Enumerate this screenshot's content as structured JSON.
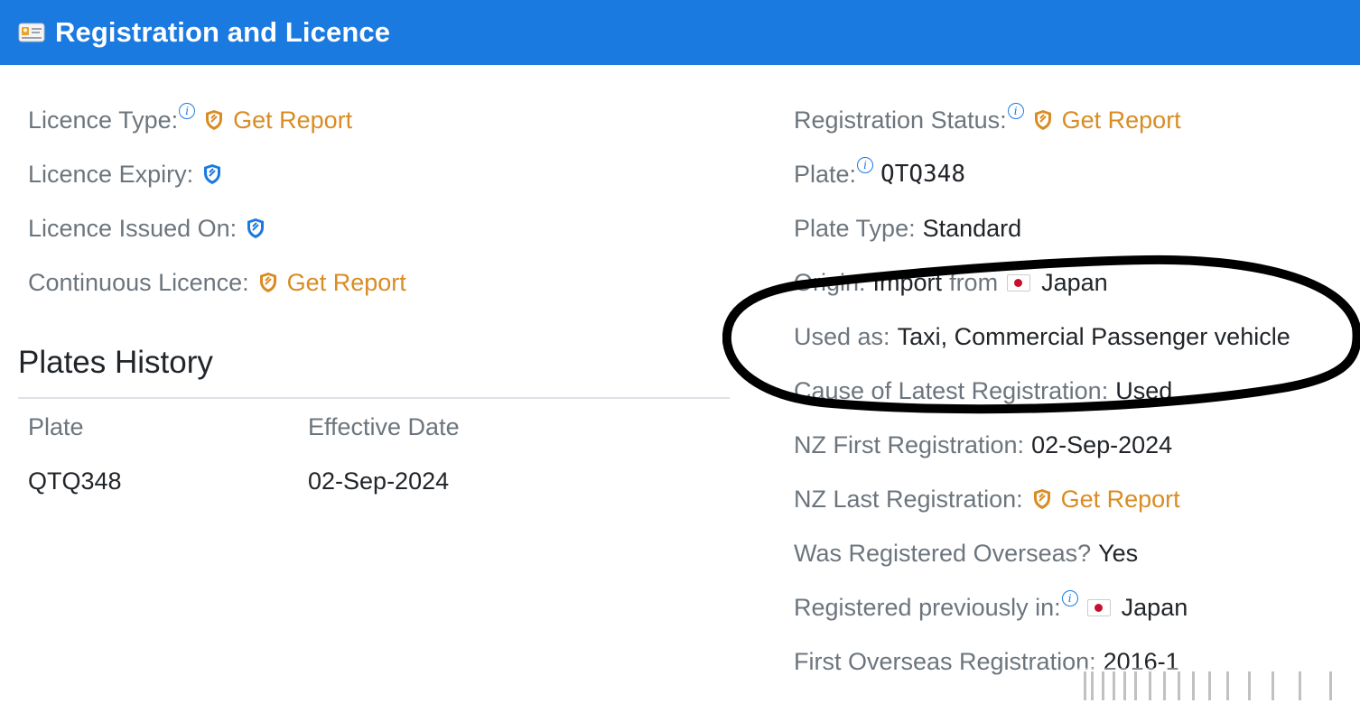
{
  "header": {
    "title": "Registration and Licence",
    "icon": "id-card-icon",
    "background": "#1b7ae0"
  },
  "left": {
    "licence_type": {
      "label": "Licence Type:",
      "action": "Get Report"
    },
    "licence_expiry": {
      "label": "Licence Expiry:"
    },
    "licence_issued_on": {
      "label": "Licence Issued On:"
    },
    "continuous_licence": {
      "label": "Continuous Licence:",
      "action": "Get Report"
    }
  },
  "plates_history": {
    "title": "Plates History",
    "columns": [
      "Plate",
      "Effective Date"
    ],
    "rows": [
      {
        "plate": "QTQ348",
        "effective_date": "02-Sep-2024"
      }
    ]
  },
  "right": {
    "registration_status": {
      "label": "Registration Status:",
      "action": "Get Report"
    },
    "plate": {
      "label": "Plate:",
      "value": "QTQ348"
    },
    "plate_type": {
      "label": "Plate Type:",
      "value": "Standard"
    },
    "origin": {
      "label": "Origin:",
      "value_prefix": "Import",
      "from": "from",
      "country": "Japan"
    },
    "used_as": {
      "label": "Used as:",
      "value": "Taxi, Commercial Passenger vehicle"
    },
    "cause_latest_registration": {
      "label": "Cause of Latest Registration:",
      "value": "Used"
    },
    "nz_first_registration": {
      "label": "NZ First Registration:",
      "value": "02-Sep-2024"
    },
    "nz_last_registration": {
      "label": "NZ Last Registration:",
      "action": "Get Report"
    },
    "registered_overseas": {
      "label": "Was Registered Overseas?",
      "value": "Yes"
    },
    "registered_previously_in": {
      "label": "Registered previously in:",
      "country": "Japan"
    },
    "first_overseas_registration": {
      "label": "First Overseas Registration:",
      "value": "2016-1"
    }
  },
  "colors": {
    "accent": "#1b7ae0",
    "report_link": "#d98c23",
    "label": "#6c757d",
    "value": "#212529"
  }
}
